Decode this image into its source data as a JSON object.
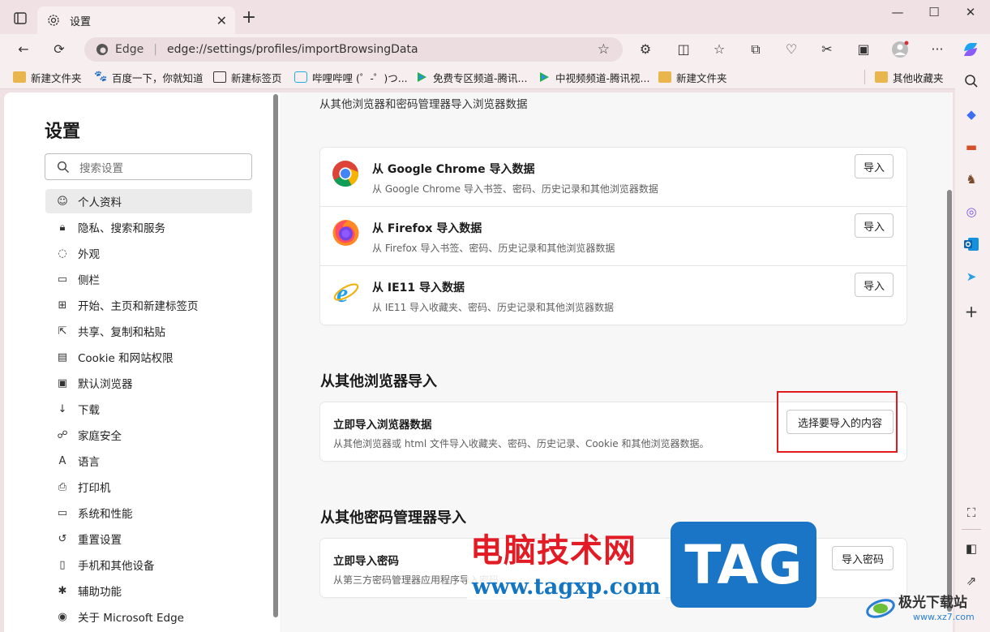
{
  "tab": {
    "title": "设置"
  },
  "address": {
    "site_label": "Edge",
    "url": "edge://settings/profiles/importBrowsingData"
  },
  "bookmarks": [
    {
      "label": "新建文件夹"
    },
    {
      "label": "百度一下，你就知道"
    },
    {
      "label": "新建标签页"
    },
    {
      "label": "哔哩哔哩 (゜-゜)つ..."
    },
    {
      "label": "免费专区频道-腾讯..."
    },
    {
      "label": "中视频频道-腾讯视..."
    },
    {
      "label": "新建文件夹"
    },
    {
      "label": "其他收藏夹"
    }
  ],
  "sidebar": {
    "title": "设置",
    "search_placeholder": "搜索设置",
    "items": [
      {
        "label": "个人资料"
      },
      {
        "label": "隐私、搜索和服务"
      },
      {
        "label": "外观"
      },
      {
        "label": "侧栏"
      },
      {
        "label": "开始、主页和新建标签页"
      },
      {
        "label": "共享、复制和粘贴"
      },
      {
        "label": "Cookie 和网站权限"
      },
      {
        "label": "默认浏览器"
      },
      {
        "label": "下载"
      },
      {
        "label": "家庭安全"
      },
      {
        "label": "语言"
      },
      {
        "label": "打印机"
      },
      {
        "label": "系统和性能"
      },
      {
        "label": "重置设置"
      },
      {
        "label": "手机和其他设备"
      },
      {
        "label": "辅助功能"
      },
      {
        "label": "关于 Microsoft Edge"
      }
    ]
  },
  "main": {
    "top_heading": "从其他浏览器和密码管理器导入浏览器数据",
    "browsers": [
      {
        "title": "从 Google Chrome 导入数据",
        "desc": "从 Google Chrome 导入书签、密码、历史记录和其他浏览器数据",
        "button": "导入"
      },
      {
        "title": "从 Firefox 导入数据",
        "desc": "从 Firefox 导入书签、密码、历史记录和其他浏览器数据",
        "button": "导入"
      },
      {
        "title": "从 IE11 导入数据",
        "desc": "从 IE11 导入收藏夹、密码、历史记录和其他浏览器数据",
        "button": "导入"
      }
    ],
    "other_browsers": {
      "heading": "从其他浏览器导入",
      "title": "立即导入浏览器数据",
      "desc": "从其他浏览器或 html 文件导入收藏夹、密码、历史记录、Cookie 和其他浏览器数据。",
      "button": "选择要导入的内容"
    },
    "password_managers": {
      "heading": "从其他密码管理器导入",
      "title": "立即导入密码",
      "desc": "从第三方密码管理器应用程序导入密码",
      "button": "导入密码"
    }
  },
  "watermark": {
    "text": "电脑技术网",
    "url": "www.tagxp.com",
    "badge": "TAG",
    "site": "极光下载站",
    "site_url": "www.xz7.com"
  },
  "colors": {
    "highlight": "#e01b1b",
    "accent": "#0f6cbd"
  }
}
